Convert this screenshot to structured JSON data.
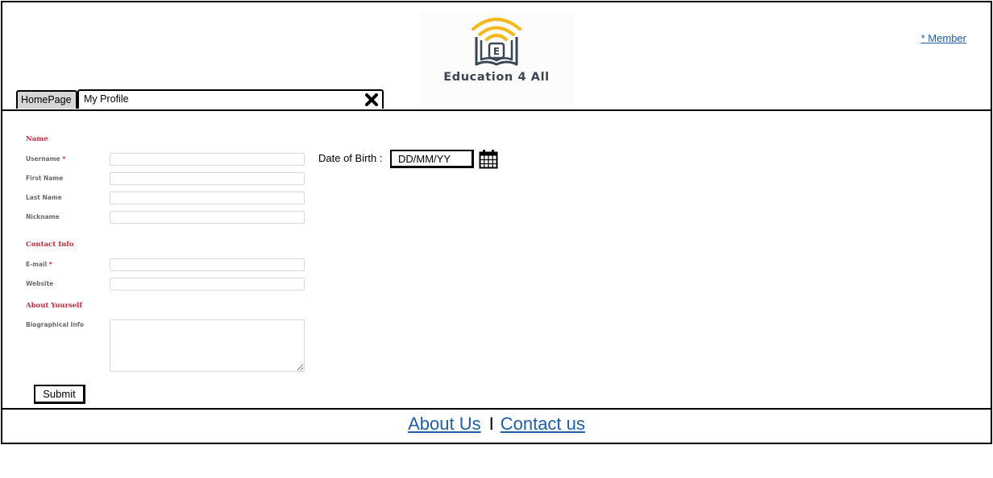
{
  "header": {
    "logo_letter": "E",
    "logo_text": "Education 4 All",
    "member_link": "* Member"
  },
  "tabs": [
    {
      "label": "HomePage"
    },
    {
      "label": "My Profile"
    }
  ],
  "form": {
    "sections": {
      "name": "Name",
      "contact": "Contact Info",
      "about": "About Yourself"
    },
    "fields": {
      "username": {
        "label": "Username",
        "required_mark": "*",
        "value": ""
      },
      "first_name": {
        "label": "First Name",
        "value": ""
      },
      "last_name": {
        "label": "Last Name",
        "value": ""
      },
      "nickname": {
        "label": "Nickname",
        "value": ""
      },
      "email": {
        "label": "E-mail",
        "required_mark": "*",
        "value": ""
      },
      "website": {
        "label": "Website",
        "value": ""
      },
      "bio": {
        "label": "Biographical Info",
        "value": ""
      }
    },
    "submit_label": "Submit",
    "dob": {
      "label": "Date of Birth :",
      "value": "DD/MM/YY"
    }
  },
  "footer": {
    "about": "About Us",
    "separator": "I",
    "contact": "Contact us"
  },
  "colors": {
    "accent_red": "#c8283c",
    "link_blue": "#1d5fa8",
    "logo_yellow": "#f5b81c",
    "logo_dark": "#3c4554"
  },
  "icons": {
    "logo": "book-wifi-logo-icon",
    "close": "close-x-icon",
    "calendar": "calendar-icon"
  }
}
